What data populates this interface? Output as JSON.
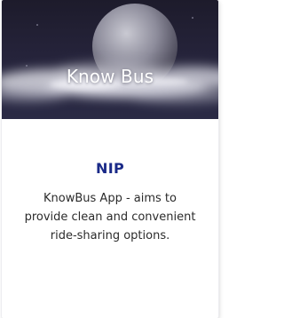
{
  "card": {
    "banner_title": "Know Bus",
    "heading": "NIP",
    "description": "KnowBus App - aims to provide clean and convenient ride-sharing options.",
    "heading_color": "#1a2a88",
    "banner_bg_color": "#25233a"
  },
  "icons": {
    "banner_art": "moon-and-clouds"
  }
}
